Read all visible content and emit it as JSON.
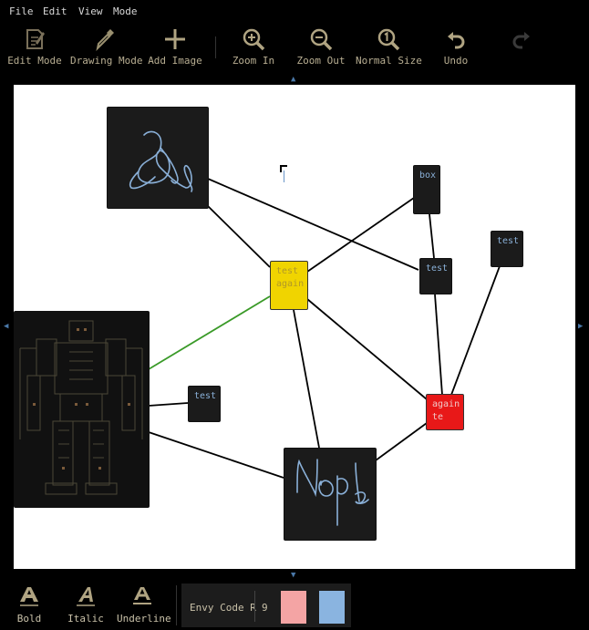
{
  "menu": [
    "File",
    "Edit",
    "View",
    "Mode"
  ],
  "toolbar": {
    "edit_mode": "Edit Mode",
    "drawing_mode": "Drawing Mode",
    "add_image": "Add Image",
    "zoom_in": "Zoom In",
    "zoom_out": "Zoom Out",
    "normal_size": "Normal Size",
    "undo": "Undo"
  },
  "nodes": {
    "box": "box",
    "test_mid": "test",
    "test_right": "test",
    "test_again": "test\nagain",
    "againte": "again\nte",
    "test_left": "test"
  },
  "format": {
    "bold": "Bold",
    "italic": "Italic",
    "underline": "Underline",
    "font_name": "Envy Code R",
    "font_size": "9",
    "fill_color": "#f4a4a4",
    "text_color": "#8ab4e0"
  },
  "colors": {
    "accent_line": "#3a9a28",
    "node_dark": "#1b1b1b",
    "node_yellow": "#f0d400",
    "node_red": "#e81818",
    "scribble": "#8ab0d8"
  }
}
